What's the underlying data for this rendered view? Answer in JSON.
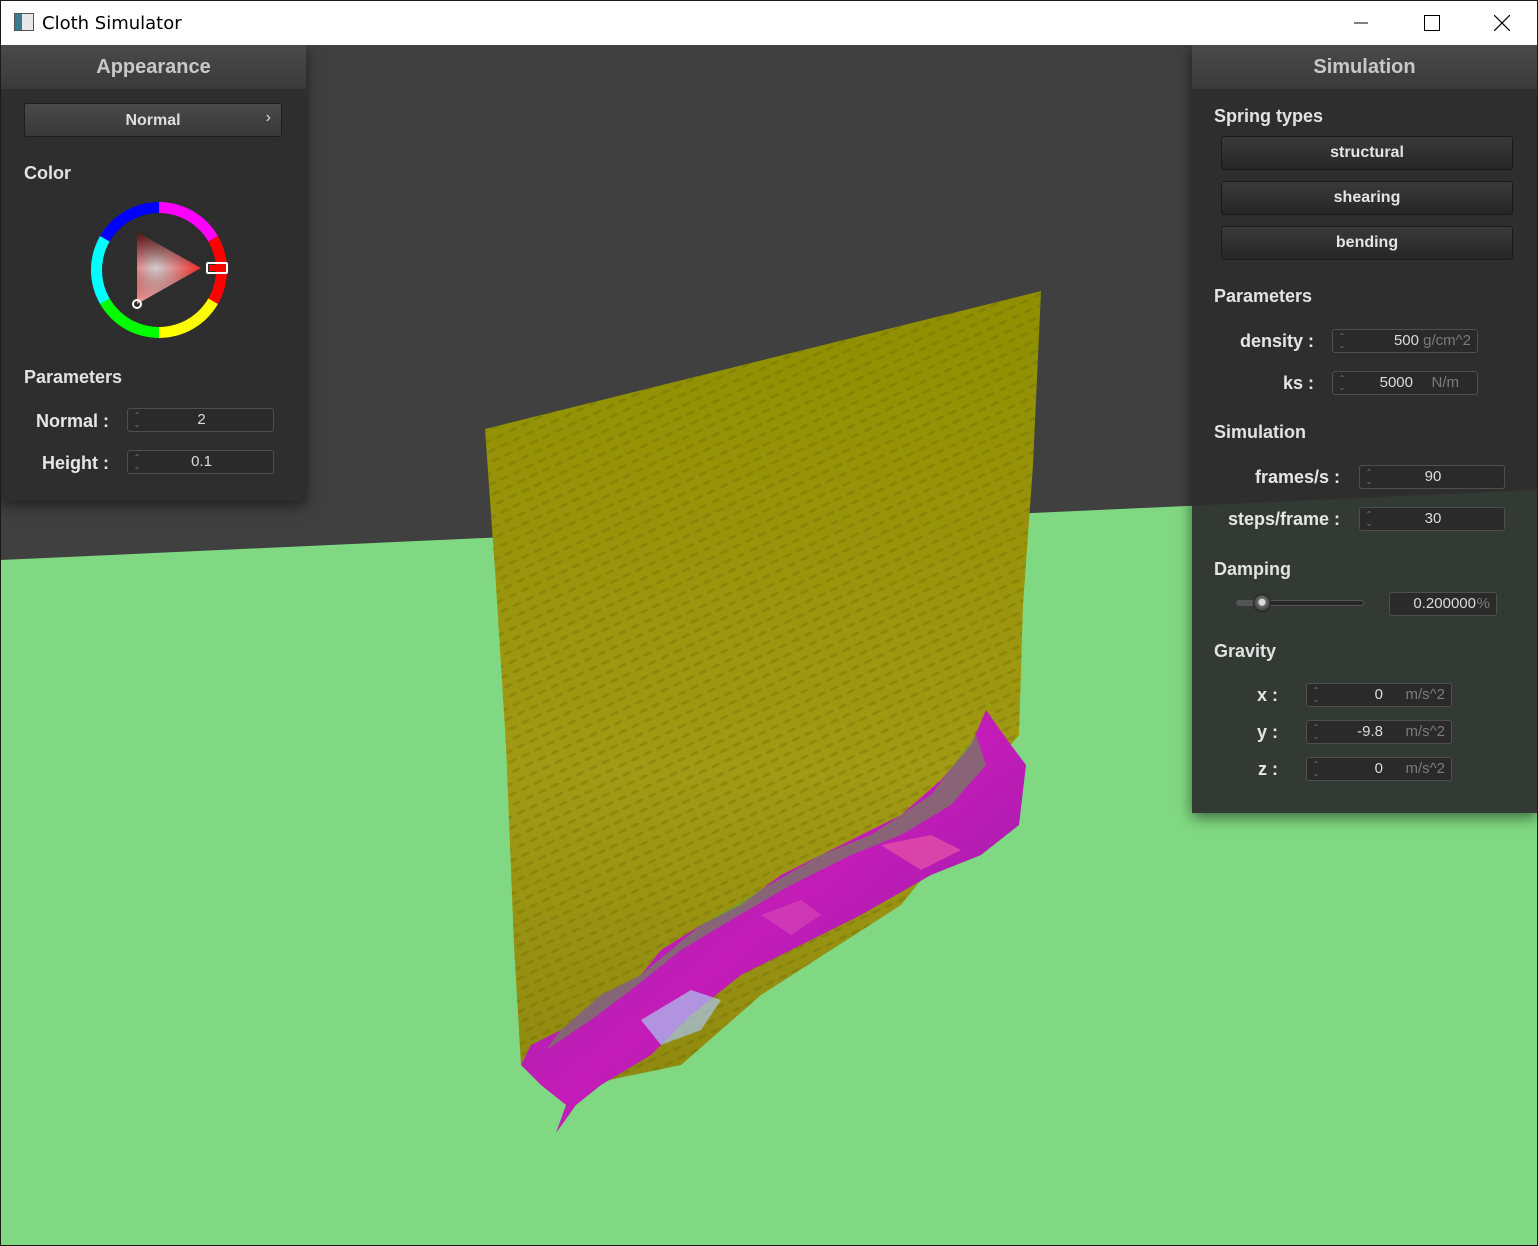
{
  "window": {
    "title": "Cloth Simulator"
  },
  "appearance": {
    "title": "Appearance",
    "shader_mode": "Normal",
    "color_label": "Color",
    "selected_color": "#ff0000",
    "params_title": "Parameters",
    "normal": {
      "label": "Normal :",
      "value": "2"
    },
    "height": {
      "label": "Height :",
      "value": "0.1"
    }
  },
  "simulation": {
    "title": "Simulation",
    "spring_types_label": "Spring types",
    "spring_types": [
      "structural",
      "shearing",
      "bending"
    ],
    "params_title": "Parameters",
    "density": {
      "label": "density :",
      "value": "500",
      "unit": "g/cm^2"
    },
    "ks": {
      "label": "ks :",
      "value": "5000",
      "unit": "N/m"
    },
    "sim_title": "Simulation",
    "fps": {
      "label": "frames/s :",
      "value": "90"
    },
    "steps": {
      "label": "steps/frame :",
      "value": "30"
    },
    "damping_label": "Damping",
    "damping": {
      "value": "0.200000",
      "unit": "%",
      "fraction": 0.2
    },
    "gravity_label": "Gravity",
    "gravity": [
      {
        "label": "x :",
        "value": "0",
        "unit": "m/s^2"
      },
      {
        "label": "y :",
        "value": "-9.8",
        "unit": "m/s^2"
      },
      {
        "label": "z :",
        "value": "0",
        "unit": "m/s^2"
      }
    ]
  },
  "scene": {
    "background": "#404040",
    "ground": "#80d982",
    "cloth_base": "#9e9e0c",
    "cloth_folds": "#b021b0"
  }
}
